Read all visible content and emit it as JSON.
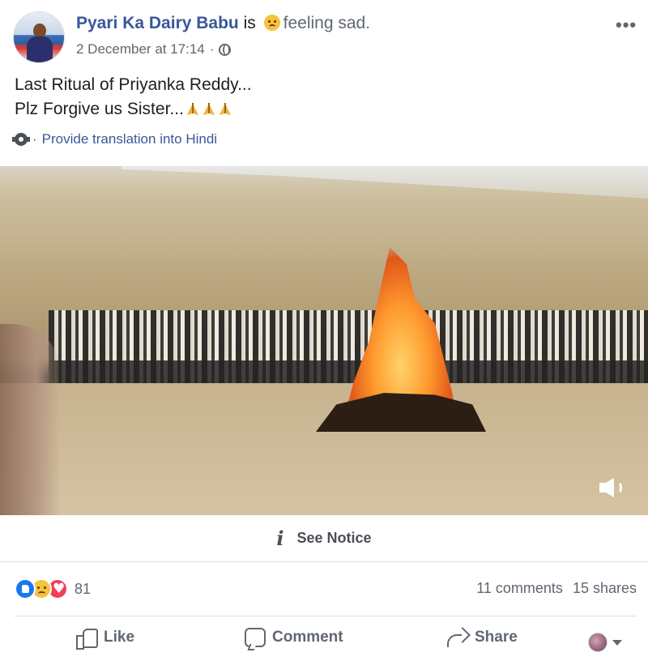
{
  "post": {
    "author": "Pyari Ka Dairy Babu",
    "is_text": "is",
    "feeling_icon": "sad-face-emoji-icon",
    "feeling": "feeling sad.",
    "timestamp": "2 December at 17:14",
    "meta_separator": "·",
    "privacy_icon": "globe-icon",
    "more_label": "•••",
    "text_line_1": "Last Ritual of Priyanka Reddy...",
    "text_line_2": "Plz Forgive us Sister...",
    "text_emoji": "folded-hands-emoji-icon",
    "translate_separator": "·",
    "translate_label": "Provide translation into Hindi"
  },
  "video": {
    "volume_icon": "volume-icon"
  },
  "notice": {
    "icon_glyph": "i",
    "label": "See Notice"
  },
  "stats": {
    "reactions": [
      "like",
      "sad",
      "love"
    ],
    "reaction_count": "81",
    "comments": "11 comments",
    "shares": "15 shares"
  },
  "actions": {
    "like_label": "Like",
    "comment_label": "Comment",
    "share_label": "Share"
  },
  "colors": {
    "link": "#385898",
    "muted": "#606770",
    "like_blue": "#1877f2",
    "love_red": "#f33e58",
    "sad_yellow": "#f7c23e"
  }
}
